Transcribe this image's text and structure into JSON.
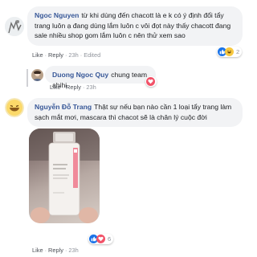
{
  "comments": [
    {
      "author": "Ngoc Nguyen",
      "text": "từ khi dùng đến chacott là e k có ý định đổi tẩy trang luôn ạ đang dùng lắm luôn c vôi đọt này thấy chacott đang sale nhiều shop gom lắm luôn c nên thử xem sao",
      "actions": {
        "like": "Like",
        "reply": "Reply",
        "time": "23h",
        "edited": "Edited"
      },
      "reaction_count": "2"
    },
    {
      "author": "Duong Ngoc Quy",
      "text": "chung team ahihi",
      "actions": {
        "like": "Like",
        "reply": "Reply",
        "time": "23h"
      },
      "reaction_count": ""
    },
    {
      "author": "Nguyễn Đỗ Trang",
      "text": "Thật sự nếu bạn nào cần 1 loại tẩy trang làm sạch mắt mơi, mascara thì chacot sẽ là chân lý cuộc đời",
      "actions": {
        "like": "Like",
        "reply": "Reply",
        "time": "23h"
      },
      "reaction_count": "6"
    }
  ],
  "colors": {
    "link": "#385898",
    "bubble": "#f2f3f5",
    "meta": "#90949c",
    "like": "#1a73e8",
    "haha": "#f7c840",
    "love": "#f25268"
  },
  "icons": [
    "like-icon",
    "haha-icon",
    "love-icon"
  ]
}
